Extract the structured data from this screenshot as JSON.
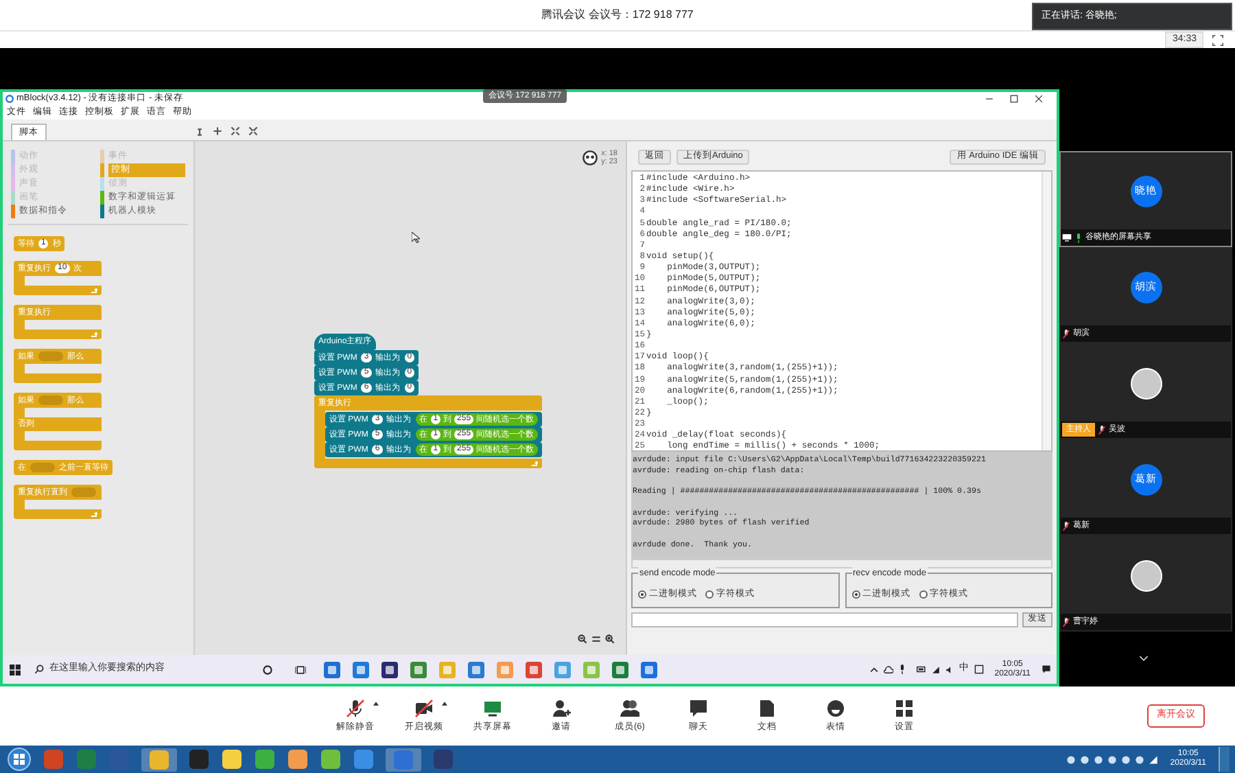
{
  "meeting": {
    "title": "腾讯会议 会议号：172 918 777",
    "speaking": "正在讲话: 谷晓艳;",
    "duration": "34:33"
  },
  "shared_screen": {
    "badge": "会议号 172 918 777",
    "app": {
      "title": "mBlock(v3.4.12) - 没有连接串口 - 未保存",
      "menu": [
        "文件",
        "编辑",
        "连接",
        "控制板",
        "扩展",
        "语言",
        "帮助"
      ],
      "tabs": [
        {
          "label": "脚本",
          "selected": true
        }
      ],
      "categories": [
        {
          "label": "动作",
          "color": "#b9c3ec",
          "selected": false,
          "disabled": true
        },
        {
          "label": "事件",
          "color": "#e6cdae",
          "selected": false,
          "disabled": true
        },
        {
          "label": "外观",
          "color": "#d2bdf0",
          "selected": false,
          "disabled": true
        },
        {
          "label": "控制",
          "color": "#e1a91a",
          "selected": true,
          "disabled": false
        },
        {
          "label": "声音",
          "color": "#e6b9ea",
          "selected": false,
          "disabled": true
        },
        {
          "label": "侦测",
          "color": "#b6def3",
          "selected": false,
          "disabled": true
        },
        {
          "label": "画笔",
          "color": "#a9dcc8",
          "selected": false,
          "disabled": true
        },
        {
          "label": "数字和逻辑运算",
          "color": "#5cb712",
          "selected": false,
          "disabled": false
        },
        {
          "label": "数据和指令",
          "color": "#ee7d16",
          "selected": false,
          "disabled": false
        },
        {
          "label": "机器人模块",
          "color": "#0e7a8c",
          "selected": false,
          "disabled": false
        }
      ],
      "palette_blocks": [
        {
          "kind": "stack",
          "color": "#e1a91a",
          "parts": [
            {
              "kind": "text",
              "text": "等待"
            },
            {
              "kind": "number",
              "text": "1"
            },
            {
              "kind": "text",
              "text": "秒"
            }
          ]
        },
        {
          "kind": "loop",
          "color": "#e1a91a",
          "parts": [
            {
              "kind": "text",
              "text": "重复执行"
            },
            {
              "kind": "number",
              "text": "10"
            },
            {
              "kind": "text",
              "text": "次"
            }
          ]
        },
        {
          "kind": "loop",
          "color": "#e1a91a",
          "parts": [
            {
              "kind": "text",
              "text": "重复执行"
            }
          ]
        },
        {
          "kind": "if",
          "color": "#e1a91a",
          "parts": [
            {
              "kind": "text",
              "text": "如果"
            },
            {
              "kind": "slot"
            },
            {
              "kind": "text",
              "text": "那么"
            }
          ]
        },
        {
          "kind": "if_else",
          "color": "#e1a91a",
          "parts": [
            {
              "kind": "text",
              "text": "如果"
            },
            {
              "kind": "slot"
            },
            {
              "kind": "text",
              "text": "那么"
            }
          ],
          "else_parts": [
            {
              "kind": "text",
              "text": "否则"
            }
          ]
        },
        {
          "kind": "stack",
          "color": "#e1a91a",
          "parts": [
            {
              "kind": "text",
              "text": "在"
            },
            {
              "kind": "slot"
            },
            {
              "kind": "text",
              "text": "之前一直等待"
            }
          ]
        },
        {
          "kind": "loop",
          "color": "#e1a91a",
          "parts": [
            {
              "kind": "text",
              "text": "重复执行直到"
            },
            {
              "kind": "slot"
            }
          ]
        }
      ],
      "sprite": {
        "x": "x: 18",
        "y": "y: 23"
      },
      "script": [
        {
          "kind": "hat",
          "color": "#0e7a8c",
          "parts": [
            {
              "kind": "text",
              "text": "Arduino主程序"
            }
          ]
        },
        {
          "kind": "stack",
          "color": "#0e7a8c",
          "parts": [
            {
              "kind": "text",
              "text": "设置 PWM"
            },
            {
              "kind": "number",
              "text": "3"
            },
            {
              "kind": "text",
              "text": "输出为"
            },
            {
              "kind": "number",
              "text": "0"
            }
          ]
        },
        {
          "kind": "stack",
          "color": "#0e7a8c",
          "parts": [
            {
              "kind": "text",
              "text": "设置 PWM"
            },
            {
              "kind": "number",
              "text": "5"
            },
            {
              "kind": "text",
              "text": "输出为"
            },
            {
              "kind": "number",
              "text": "0"
            }
          ]
        },
        {
          "kind": "stack",
          "color": "#0e7a8c",
          "parts": [
            {
              "kind": "text",
              "text": "设置 PWM"
            },
            {
              "kind": "number",
              "text": "6"
            },
            {
              "kind": "text",
              "text": "输出为"
            },
            {
              "kind": "number",
              "text": "0"
            }
          ]
        },
        {
          "kind": "loop",
          "color": "#e1a91a",
          "parts": [
            {
              "kind": "text",
              "text": "重复执行"
            }
          ],
          "children": [
            {
              "kind": "stack",
              "color": "#0e7a8c",
              "parts": [
                {
                  "kind": "text",
                  "text": "设置 PWM"
                },
                {
                  "kind": "number",
                  "text": "3"
                },
                {
                  "kind": "text",
                  "text": "输出为"
                },
                {
                  "kind": "reporter",
                  "parts": [
                    {
                      "kind": "text",
                      "text": "在"
                    },
                    {
                      "kind": "number",
                      "text": "1"
                    },
                    {
                      "kind": "text",
                      "text": "到"
                    },
                    {
                      "kind": "number",
                      "text": "255"
                    },
                    {
                      "kind": "text",
                      "text": "间随机选一个数"
                    }
                  ]
                }
              ]
            },
            {
              "kind": "stack",
              "color": "#0e7a8c",
              "parts": [
                {
                  "kind": "text",
                  "text": "设置 PWM"
                },
                {
                  "kind": "number",
                  "text": "5"
                },
                {
                  "kind": "text",
                  "text": "输出为"
                },
                {
                  "kind": "reporter",
                  "parts": [
                    {
                      "kind": "text",
                      "text": "在"
                    },
                    {
                      "kind": "number",
                      "text": "1"
                    },
                    {
                      "kind": "text",
                      "text": "到"
                    },
                    {
                      "kind": "number",
                      "text": "255"
                    },
                    {
                      "kind": "text",
                      "text": "间随机选一个数"
                    }
                  ]
                }
              ]
            },
            {
              "kind": "stack",
              "color": "#0e7a8c",
              "parts": [
                {
                  "kind": "text",
                  "text": "设置 PWM"
                },
                {
                  "kind": "number",
                  "text": "6"
                },
                {
                  "kind": "text",
                  "text": "输出为"
                },
                {
                  "kind": "reporter",
                  "parts": [
                    {
                      "kind": "text",
                      "text": "在"
                    },
                    {
                      "kind": "number",
                      "text": "1"
                    },
                    {
                      "kind": "text",
                      "text": "到"
                    },
                    {
                      "kind": "number",
                      "text": "255"
                    },
                    {
                      "kind": "text",
                      "text": "间随机选一个数"
                    }
                  ]
                }
              ]
            }
          ]
        }
      ],
      "buttons": [
        "返回",
        "上传到Arduino"
      ],
      "ide_button": "用 Arduino IDE 编辑",
      "code": [
        {
          "n": "1",
          "code": "#include <Arduino.h>"
        },
        {
          "n": "2",
          "code": "#include <Wire.h>"
        },
        {
          "n": "3",
          "code": "#include <SoftwareSerial.h>"
        },
        {
          "n": "4"
        },
        {
          "n": "5",
          "code": "double angle_rad = PI/180.0;"
        },
        {
          "n": "6",
          "code": "double angle_deg = 180.0/PI;"
        },
        {
          "n": "7"
        },
        {
          "n": "8",
          "code": "void setup(){"
        },
        {
          "n": "9",
          "code": "    pinMode(3,OUTPUT);"
        },
        {
          "n": "10",
          "code": "    pinMode(5,OUTPUT);"
        },
        {
          "n": "11",
          "code": "    pinMode(6,OUTPUT);"
        },
        {
          "n": "12",
          "code": "    analogWrite(3,0);"
        },
        {
          "n": "13",
          "code": "    analogWrite(5,0);"
        },
        {
          "n": "14",
          "code": "    analogWrite(6,0);"
        },
        {
          "n": "15",
          "code": "}"
        },
        {
          "n": "16"
        },
        {
          "n": "17",
          "code": "void loop(){"
        },
        {
          "n": "18",
          "code": "    analogWrite(3,random(1,(255)+1));"
        },
        {
          "n": "19",
          "code": "    analogWrite(5,random(1,(255)+1));"
        },
        {
          "n": "20",
          "code": "    analogWrite(6,random(1,(255)+1));"
        },
        {
          "n": "21",
          "code": "    _loop();"
        },
        {
          "n": "22",
          "code": "}"
        },
        {
          "n": "23"
        },
        {
          "n": "24",
          "code": "void _delay(float seconds){"
        },
        {
          "n": "25",
          "code": "    long endTime = millis() + seconds * 1000;"
        }
      ],
      "log": [
        [
          "avrdude: input file C:\\Users\\G2\\AppData\\Local\\Temp\\build771634223220359221",
          "avrdude: reading on-chip flash data:"
        ],
        [
          "Reading | ################################################## | 100% 0.39s"
        ],
        [
          "avrdude: verifying ...",
          "avrdude: 2980 bytes of flash verified"
        ],
        [
          "avrdude done.  Thank you."
        ]
      ],
      "encode_modes": [
        {
          "legend": "send encode mode",
          "options": [
            {
              "label": "二进制模式",
              "selected": true
            },
            {
              "label": "字符模式",
              "selected": false
            }
          ]
        },
        {
          "legend": "recv encode mode",
          "options": [
            {
              "label": "二进制模式",
              "selected": true
            },
            {
              "label": "字符模式",
              "selected": false
            }
          ]
        }
      ],
      "send_button": "发送"
    },
    "taskbar": {
      "search_placeholder": "在这里输入你要搜索的内容",
      "ime": "中",
      "time": "10:05",
      "date": "2020/3/11"
    }
  },
  "participants": [
    {
      "name": "谷晓艳的屏幕共享",
      "avatar": {
        "kind": "initials",
        "text": "晓艳"
      },
      "sharing": true,
      "muted": false,
      "selected": true
    },
    {
      "name": "胡滨",
      "avatar": {
        "kind": "initials",
        "text": "胡滨"
      },
      "sharing": false,
      "muted": true,
      "selected": false
    },
    {
      "name": "吴波",
      "avatar": {
        "kind": "photo"
      },
      "badge": "主持人",
      "sharing": false,
      "muted": true,
      "selected": false
    },
    {
      "name": "葛新",
      "avatar": {
        "kind": "initials",
        "text": "葛新"
      },
      "sharing": false,
      "muted": true,
      "selected": false
    },
    {
      "name": "曹宇婷",
      "avatar": {
        "kind": "photo"
      },
      "sharing": false,
      "muted": true,
      "selected": false
    }
  ],
  "toolbar": [
    {
      "kind": "mic",
      "label": "解除静音",
      "off": true,
      "menu": true
    },
    {
      "kind": "video",
      "label": "开启视频",
      "off": true,
      "menu": true
    },
    {
      "kind": "share",
      "label": "共享屏幕",
      "off": false,
      "menu": false
    },
    {
      "kind": "invite",
      "label": "邀请",
      "off": false,
      "menu": false
    },
    {
      "kind": "members",
      "label": "成员(6)",
      "off": false,
      "menu": false
    },
    {
      "kind": "chat",
      "label": "聊天",
      "off": false,
      "menu": false
    },
    {
      "kind": "doc",
      "label": "文档",
      "off": false,
      "menu": false
    },
    {
      "kind": "emoji",
      "label": "表情",
      "off": false,
      "menu": false
    },
    {
      "kind": "settings",
      "label": "设置",
      "off": false,
      "menu": false
    }
  ],
  "leave_button": "离开会议",
  "os_taskbar": {
    "time": "10:05",
    "date": "2020/3/11"
  }
}
